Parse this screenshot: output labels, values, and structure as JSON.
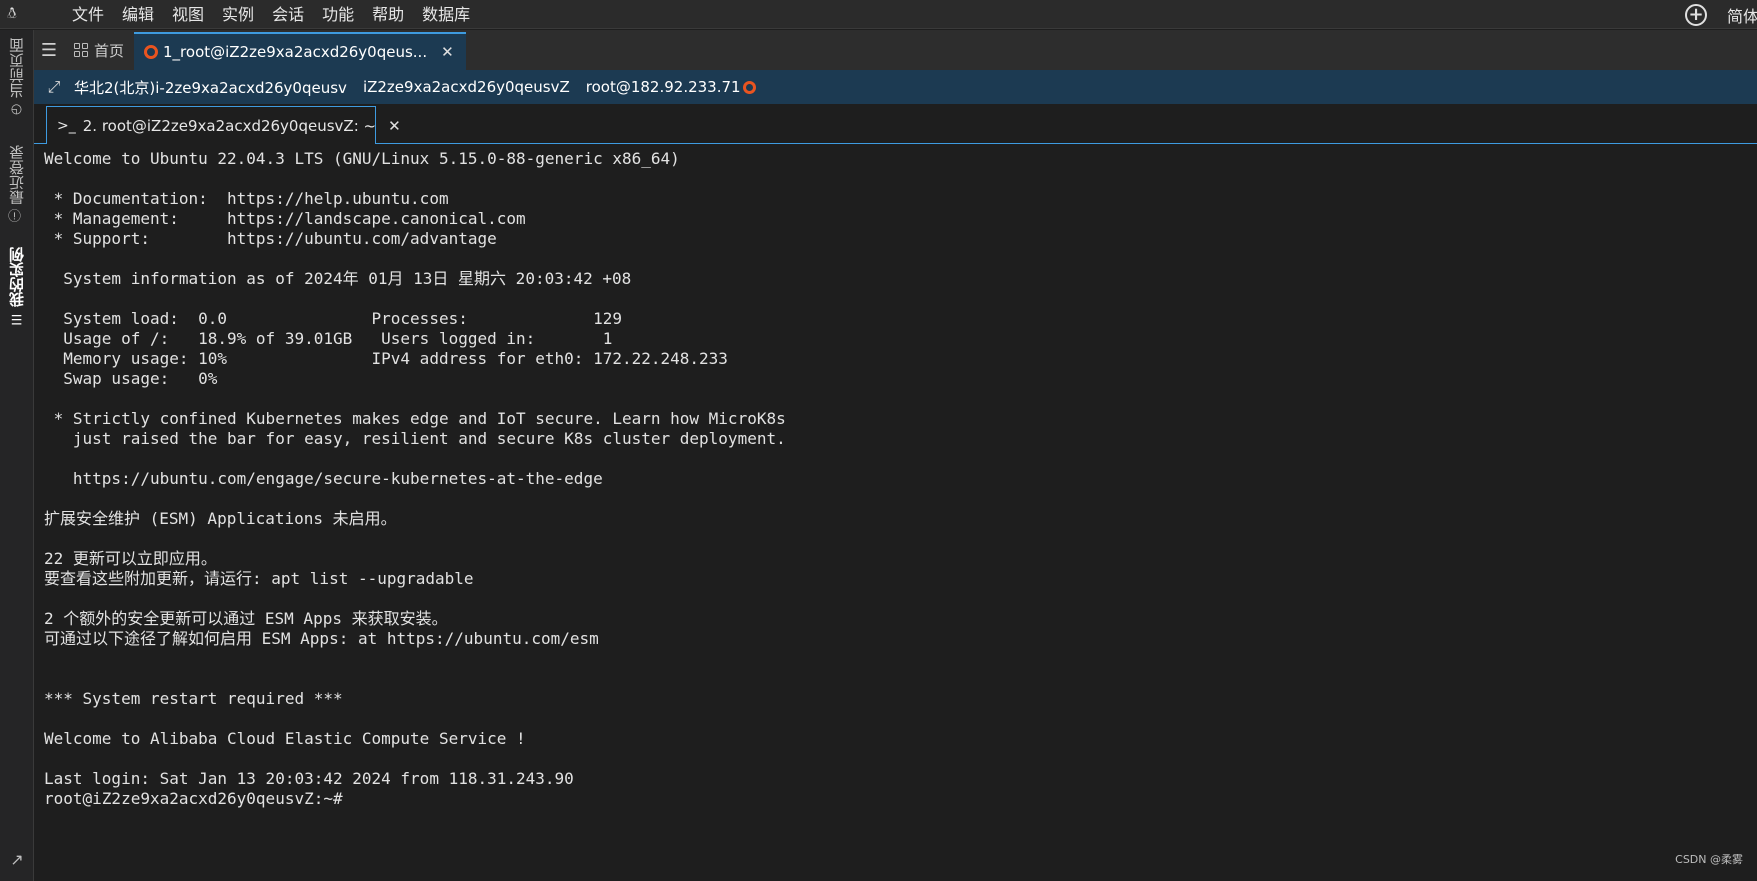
{
  "menubar": {
    "app_icon": "penguin-icon",
    "items": [
      "文件",
      "编辑",
      "视图",
      "实例",
      "会话",
      "功能",
      "帮助",
      "数据库"
    ],
    "language": "简体"
  },
  "sidebar": {
    "tabs": [
      {
        "label": "当前页面",
        "icon": "clock-icon"
      },
      {
        "label": "最近登录",
        "icon": "info-icon"
      },
      {
        "label": "我的实例",
        "icon": "list-icon"
      }
    ]
  },
  "tabbar": {
    "home_label": "首页",
    "session_label": "1_root@iZ2ze9xa2acxd26y0qeus..."
  },
  "infobar": {
    "region": "华北2(北京)i-2ze9xa2acxd26y0qeusv",
    "hostname": "iZ2ze9xa2acxd26y0qeusvZ",
    "login": "root@182.92.233.71"
  },
  "subtab": {
    "label": "2. root@iZ2ze9xa2acxd26y0qeusvZ: ~"
  },
  "terminal": {
    "lines": [
      "Welcome to Ubuntu 22.04.3 LTS (GNU/Linux 5.15.0-88-generic x86_64)",
      "",
      " * Documentation:  https://help.ubuntu.com",
      " * Management:     https://landscape.canonical.com",
      " * Support:        https://ubuntu.com/advantage",
      "",
      "  System information as of 2024年 01月 13日 星期六 20:03:42 +08",
      "",
      "  System load:  0.0               Processes:             129",
      "  Usage of /:   18.9% of 39.01GB   Users logged in:       1",
      "  Memory usage: 10%               IPv4 address for eth0: 172.22.248.233",
      "  Swap usage:   0%",
      "",
      " * Strictly confined Kubernetes makes edge and IoT secure. Learn how MicroK8s",
      "   just raised the bar for easy, resilient and secure K8s cluster deployment.",
      "",
      "   https://ubuntu.com/engage/secure-kubernetes-at-the-edge",
      "",
      "扩展安全维护 (ESM) Applications 未启用。",
      "",
      "22 更新可以立即应用。",
      "要查看这些附加更新，请运行: apt list --upgradable",
      "",
      "2 个额外的安全更新可以通过 ESM Apps 来获取安装。",
      "可通过以下途径了解如何启用 ESM Apps: at https://ubuntu.com/esm",
      "",
      "",
      "*** System restart required ***",
      "",
      "Welcome to Alibaba Cloud Elastic Compute Service !",
      "",
      "Last login: Sat Jan 13 20:03:42 2024 from 118.31.243.90",
      "root@iZ2ze9xa2acxd26y0qeusvZ:~#"
    ]
  },
  "watermark": "CSDN @柔雾",
  "colors": {
    "accent": "#3e9be0",
    "session_bar": "#1c3a52",
    "ubuntu": "#e95420"
  }
}
